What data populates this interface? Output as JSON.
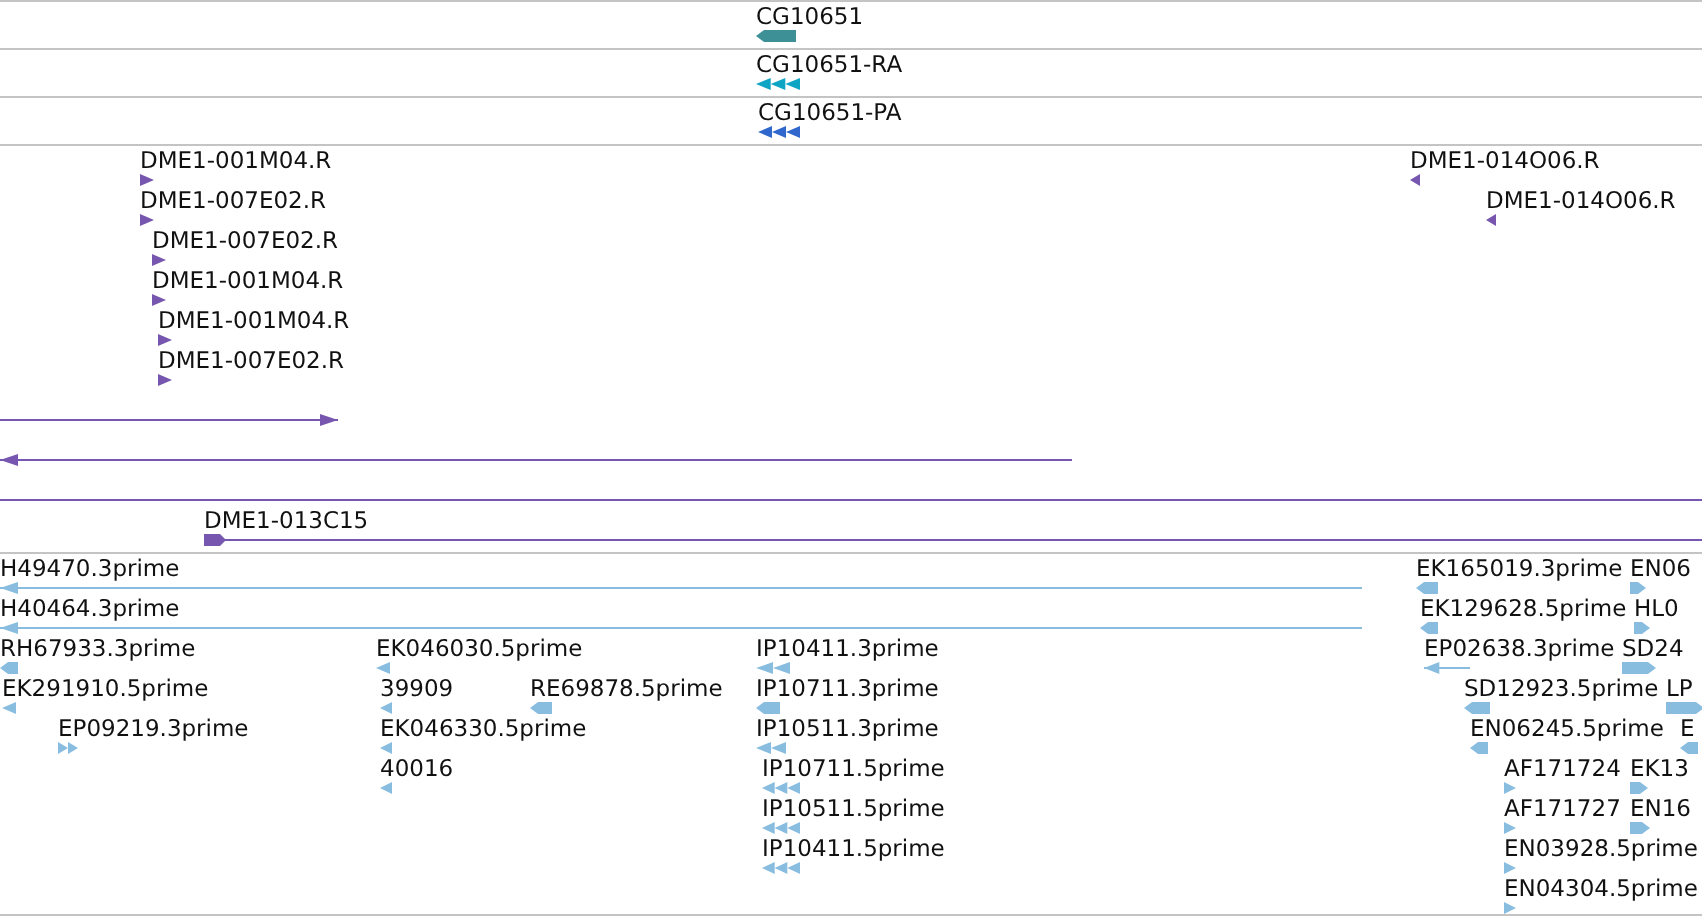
{
  "tracks": [
    {
      "color": "#3d9096",
      "features": [
        {
          "label": "CG10651",
          "kind": "bar",
          "reverse": true
        }
      ]
    },
    {
      "color": "#0ea5c4",
      "features": [
        {
          "label": "CG10651-RA",
          "kind": "triple",
          "reverse": true
        }
      ]
    },
    {
      "color": "#2f67cc",
      "features": [
        {
          "label": "CG10651-PA",
          "kind": "triple",
          "reverse": true
        }
      ]
    },
    {
      "color": "#7656ae",
      "features": [
        {
          "label": "DME1-001M04.R",
          "kind": "arrow",
          "reverse": false
        },
        {
          "label": "DME1-014O06.R",
          "kind": "arrow",
          "reverse": true
        },
        {
          "label": "DME1-007E02.R",
          "kind": "arrow",
          "reverse": false
        },
        {
          "label": "DME1-014O06.R",
          "kind": "arrow",
          "reverse": true
        },
        {
          "label": "DME1-007E02.R",
          "kind": "arrow",
          "reverse": false
        },
        {
          "label": "DME1-001M04.R",
          "kind": "arrow",
          "reverse": false
        },
        {
          "label": "DME1-001M04.R",
          "kind": "arrow",
          "reverse": false
        },
        {
          "label": "DME1-007E02.R",
          "kind": "arrow",
          "reverse": false
        },
        {
          "kind": "line",
          "reverse": false
        },
        {
          "kind": "line",
          "reverse": true
        },
        {
          "kind": "plain"
        },
        {
          "label": "DME1-013C15",
          "kind": "lead",
          "reverse": false
        }
      ]
    },
    {
      "color": "#88bde0",
      "features": [
        {
          "label": "H49470.3prime",
          "kind": "line",
          "reverse": true
        },
        {
          "label": "EK165019.3prime",
          "kind": "block",
          "reverse": true
        },
        {
          "label": "EN06",
          "kind": "block",
          "reverse": false
        },
        {
          "label": "H40464.3prime",
          "kind": "line",
          "reverse": true
        },
        {
          "label": "EK129628.5prime",
          "kind": "block",
          "reverse": true
        },
        {
          "label": "HL0",
          "kind": "block",
          "reverse": false
        },
        {
          "label": "RH67933.3prime",
          "kind": "block",
          "reverse": true
        },
        {
          "label": "EK046030.5prime",
          "kind": "arrow",
          "reverse": true
        },
        {
          "label": "IP10411.3prime",
          "kind": "double",
          "reverse": true
        },
        {
          "label": "EP02638.3prime",
          "kind": "line",
          "reverse": true
        },
        {
          "label": "SD24",
          "kind": "block",
          "reverse": false
        },
        {
          "label": "EK291910.5prime",
          "kind": "arrow",
          "reverse": true
        },
        {
          "label": "39909",
          "kind": "arrow",
          "reverse": true
        },
        {
          "label": "RE69878.5prime",
          "kind": "block",
          "reverse": true
        },
        {
          "label": "IP10711.3prime",
          "kind": "block",
          "reverse": true
        },
        {
          "label": "SD12923.5prime",
          "kind": "block",
          "reverse": true
        },
        {
          "label": "LP",
          "kind": "block",
          "reverse": false
        },
        {
          "label": "EP09219.3prime",
          "kind": "double",
          "reverse": false
        },
        {
          "label": "EK046330.5prime",
          "kind": "arrow",
          "reverse": true
        },
        {
          "label": "IP10511.3prime",
          "kind": "double",
          "reverse": true
        },
        {
          "label": "EN06245.5prime",
          "kind": "block",
          "reverse": true
        },
        {
          "label": "E",
          "kind": "block",
          "reverse": true
        },
        {
          "label": "40016",
          "kind": "arrow",
          "reverse": true
        },
        {
          "label": "IP10711.5prime",
          "kind": "triple",
          "reverse": true
        },
        {
          "label": "AF171724",
          "kind": "arrow",
          "reverse": false
        },
        {
          "label": "EK13",
          "kind": "block",
          "reverse": false
        },
        {
          "label": "IP10511.5prime",
          "kind": "triple",
          "reverse": true
        },
        {
          "label": "AF171727",
          "kind": "arrow",
          "reverse": false
        },
        {
          "label": "EN16",
          "kind": "block",
          "reverse": false
        },
        {
          "label": "IP10411.5prime",
          "kind": "triple",
          "reverse": true
        },
        {
          "label": "EN03928.5prime",
          "kind": "arrow",
          "reverse": false
        },
        {
          "label": "EN04304.5prime",
          "kind": "arrow",
          "reverse": false
        }
      ]
    }
  ]
}
